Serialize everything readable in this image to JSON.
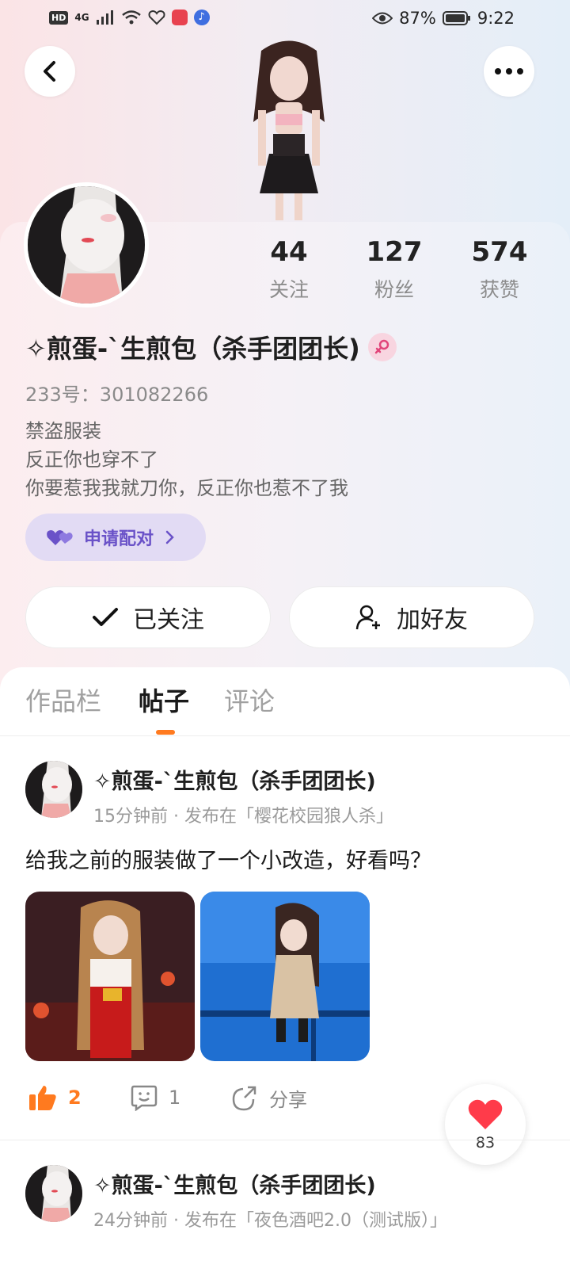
{
  "status_bar": {
    "left_badges": [
      "HD",
      "4G"
    ],
    "battery": "87%",
    "time": "9:22"
  },
  "profile": {
    "stats": [
      {
        "value": "44",
        "label": "关注"
      },
      {
        "value": "127",
        "label": "粉丝"
      },
      {
        "value": "574",
        "label": "获赞"
      }
    ],
    "name": "✧煎蛋-ˋ生煎包（杀手团团长)",
    "id_line": "233号：301082266",
    "bio_lines": [
      "禁盗服装",
      "反正你也穿不了",
      "你要惹我我就刀你，反正你也惹不了我"
    ],
    "pair_button": "申请配对",
    "follow_button": "已关注",
    "add_friend_button": "加好友"
  },
  "tabs": [
    {
      "label": "作品栏",
      "active": false
    },
    {
      "label": "帖子",
      "active": true
    },
    {
      "label": "评论",
      "active": false
    }
  ],
  "posts": [
    {
      "author": "✧煎蛋-ˋ生煎包（杀手团团长)",
      "meta": "15分钟前 · 发布在「樱花校园狼人杀」",
      "text": "给我之前的服装做了一个小改造，好看吗？",
      "likes": "2",
      "comments": "1",
      "share_label": "分享"
    },
    {
      "author": "✧煎蛋-ˋ生煎包（杀手团团长)",
      "meta": "24分钟前 · 发布在「夜色酒吧2.0（测试版）」"
    }
  ],
  "favorite_fab": {
    "count": "83"
  },
  "colors": {
    "accent": "#ff7a1f",
    "pair_text": "#6a52c8",
    "pair_bg": "#e2dbf4",
    "like": "#ff7a1f",
    "heart": "#ff3b4a"
  }
}
